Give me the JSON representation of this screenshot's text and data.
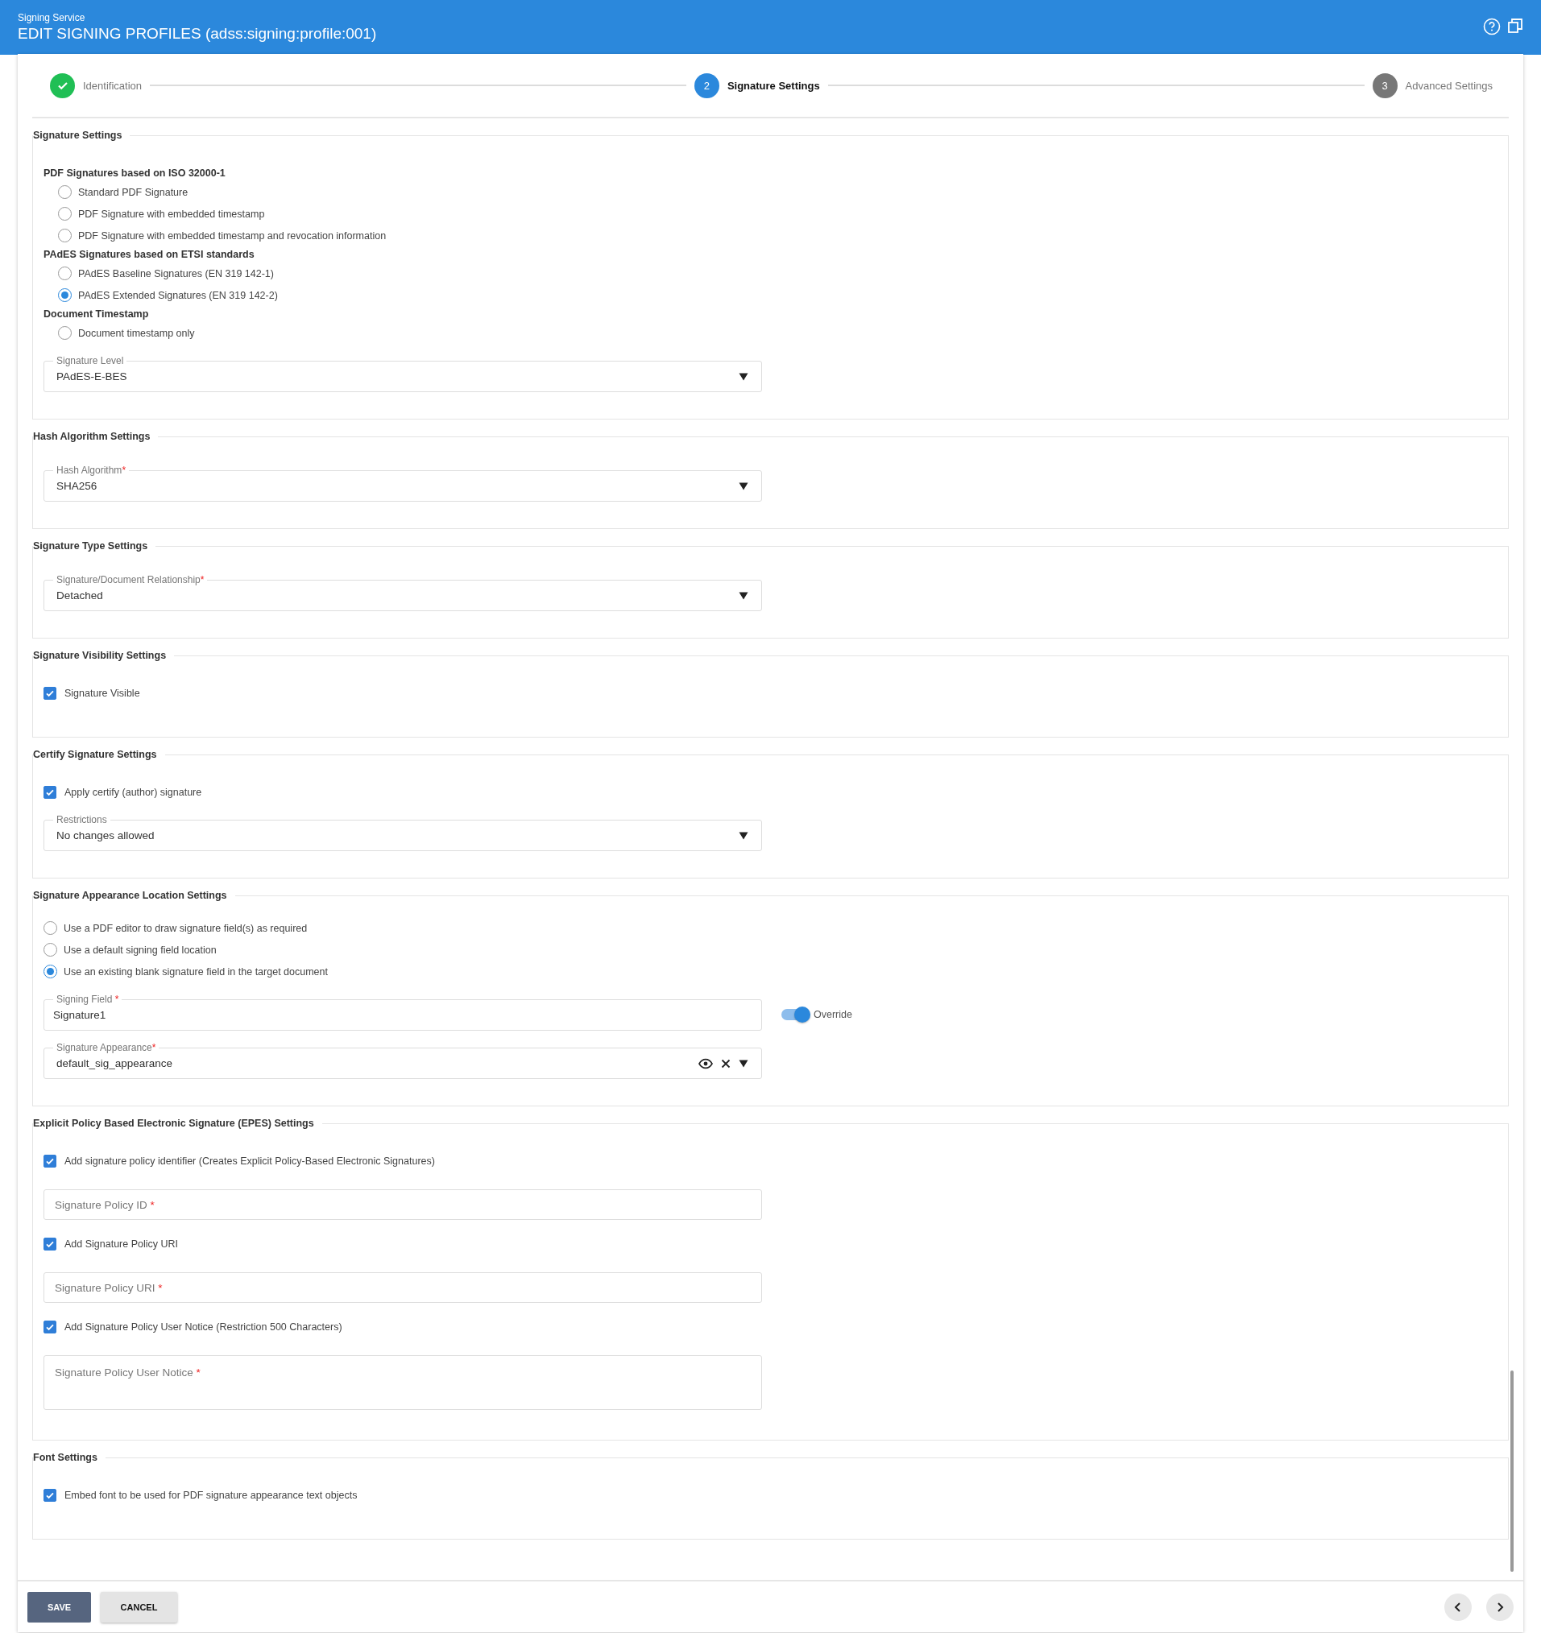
{
  "header": {
    "app_name": "Signing Service",
    "title": "EDIT SIGNING PROFILES (adss:signing:profile:001)"
  },
  "stepper": [
    {
      "label": "Identification",
      "completed": true,
      "selected": false
    },
    {
      "number": "2",
      "label": "Signature Settings",
      "completed": false,
      "selected": true
    },
    {
      "number": "3",
      "label": "Advanced Settings",
      "completed": false,
      "selected": false
    }
  ],
  "sections": [
    {
      "title": "Signature Settings",
      "items": [
        {
          "kind": "radio_group",
          "heading": "PDF Signatures based on ISO 32000-1",
          "options": [
            {
              "label": "Standard PDF Signature",
              "selected": false
            },
            {
              "label": "PDF Signature with embedded timestamp",
              "selected": false
            },
            {
              "label": "PDF Signature with embedded timestamp and revocation information",
              "selected": false
            }
          ]
        },
        {
          "kind": "radio_group",
          "heading": "PAdES Signatures based on ETSI standards",
          "options": [
            {
              "label": "PAdES Baseline Signatures (EN 319 142-1)",
              "selected": false
            },
            {
              "label": "PAdES Extended Signatures (EN 319 142-2)",
              "selected": true
            }
          ]
        },
        {
          "kind": "radio_group",
          "heading": "Document Timestamp",
          "options": [
            {
              "label": "Document timestamp only",
              "selected": false
            }
          ]
        },
        {
          "kind": "select",
          "label": "Signature Level",
          "value": "PAdES-E-BES"
        }
      ]
    },
    {
      "title": "Hash Algorithm Settings",
      "items": [
        {
          "kind": "select",
          "label": "Hash Algorithm",
          "mark": "*",
          "value": "SHA256"
        }
      ]
    },
    {
      "title": "Signature Type Settings",
      "items": [
        {
          "kind": "select",
          "label": "Signature/Document Relationship",
          "mark": "*",
          "value": "Detached"
        }
      ]
    },
    {
      "title": "Signature Visibility Settings",
      "items": [
        {
          "kind": "checkbox",
          "label": "Signature Visible",
          "checked": true
        }
      ]
    },
    {
      "title": "Certify Signature Settings",
      "items": [
        {
          "kind": "checkbox",
          "label": "Apply certify (author) signature",
          "checked": true
        },
        {
          "kind": "select",
          "label": "Restrictions",
          "value": "No changes allowed"
        }
      ]
    },
    {
      "title": "Signature Appearance Location Settings",
      "items": [
        {
          "kind": "radio_group",
          "options": [
            {
              "label": "Use a PDF editor to draw signature field(s) as required",
              "selected": false
            },
            {
              "label": "Use a default signing field location",
              "selected": false
            },
            {
              "label": "Use an existing blank signature field in the target document",
              "selected": true
            }
          ]
        },
        {
          "kind": "text_field",
          "label": "Signing Field",
          "mark": "*",
          "value": "Signature1",
          "toggle": {
            "label": "Override",
            "on": true
          }
        },
        {
          "kind": "lookup",
          "label": "Signature Appearance",
          "mark": "*",
          "value": "default_sig_appearance"
        }
      ]
    },
    {
      "title": "Explicit Policy Based Electronic Signature (EPES) Settings",
      "items": [
        {
          "kind": "checkbox",
          "label": "Add signature policy identifier (Creates Explicit Policy-Based Electronic Signatures)",
          "checked": true
        },
        {
          "kind": "text_field",
          "label": "Signature Policy ID",
          "mark": "*"
        },
        {
          "kind": "checkbox",
          "label": "Add Signature Policy URI",
          "checked": true
        },
        {
          "kind": "text_field",
          "label": "Signature Policy URI",
          "mark": "*"
        },
        {
          "kind": "checkbox",
          "label": "Add Signature Policy User Notice (Restriction 500 Characters)",
          "checked": true
        },
        {
          "kind": "textarea",
          "label": "Signature Policy User Notice",
          "mark": "*"
        }
      ]
    },
    {
      "title": "Font Settings",
      "items": [
        {
          "kind": "checkbox",
          "label": "Embed font to be used for PDF signature appearance text objects",
          "checked": true
        }
      ]
    }
  ],
  "footer": {
    "buttons": [
      {
        "label": "SAVE",
        "kind": "primary"
      },
      {
        "label": "CANCEL",
        "kind": "secondary"
      }
    ]
  }
}
